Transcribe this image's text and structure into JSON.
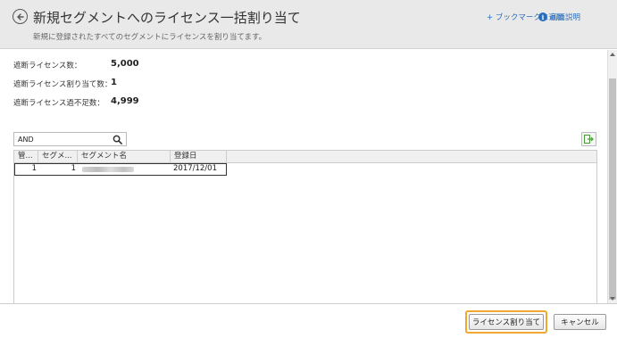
{
  "header": {
    "title": "新規セグメントへのライセンス一括割り当て",
    "subtitle": "新規に登録されたすべてのセグメントにライセンスを割り当てます。",
    "bookmark_label": "+ ブックマークに追加",
    "help_label": "画面説明",
    "back_icon": "back-arrow-icon",
    "help_icon": "info-icon"
  },
  "stats": [
    {
      "label": "遮断ライセンス数：",
      "value": "5,000"
    },
    {
      "label": "遮断ライセンス割り当て数：",
      "value": "1"
    },
    {
      "label": "遮断ライセンス過不足数：",
      "value": "4,999"
    }
  ],
  "search": {
    "value": "AND",
    "icon": "search-icon"
  },
  "export_icon": "export-icon",
  "grid": {
    "columns": [
      "管...",
      "セグメ...",
      "セグメント名",
      "登録日"
    ],
    "rows": [
      {
        "col0": "1",
        "col1": "1",
        "col2": "",
        "col3": "2017/12/01"
      }
    ]
  },
  "footer": {
    "assign_label": "ライセンス割り当て",
    "cancel_label": "キャンセル"
  },
  "colors": {
    "accent": "#2a6ebb",
    "focus": "#f0a830",
    "header_bg": "#e9e9e9"
  }
}
